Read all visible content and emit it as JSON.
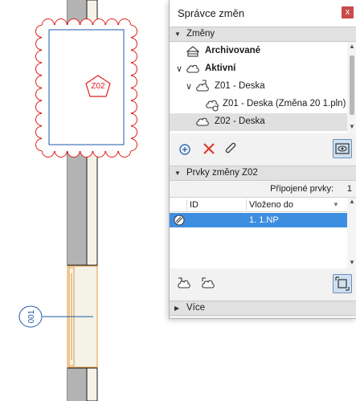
{
  "drawing": {
    "revision_tag": "Z02",
    "marker_label": "001"
  },
  "palette": {
    "title": "Správce změn",
    "close_label": "x",
    "changes_section": "Změny",
    "tree": [
      {
        "label": "Archivované",
        "bold": true,
        "expander": "",
        "icon": "archive-icon"
      },
      {
        "label": "Aktivní",
        "bold": true,
        "expander": "∨",
        "icon": "cloud-icon"
      },
      {
        "label": "Z01 - Deska",
        "bold": false,
        "expander": "∨",
        "icon": "issue-cloud-icon"
      },
      {
        "label": "Z01 - Deska (Změna 20 1.pln)",
        "bold": false,
        "expander": "",
        "icon": "linked-cloud-icon"
      },
      {
        "label": "Z02 - Deska",
        "bold": false,
        "expander": "",
        "icon": "cloud-icon"
      }
    ],
    "elements_section": "Prvky změny Z02",
    "connected_label": "Připojené prvky:",
    "connected_count": "1",
    "columns": {
      "id": "ID",
      "placed_in": "Vloženo do"
    },
    "rows": [
      {
        "id": "",
        "placed_in": "1. 1.NP",
        "icon": "slab-element-icon"
      }
    ],
    "more_section": "Více",
    "colors": {
      "selection": "#3d8ee0",
      "delete": "#e03a2f",
      "close": "#c94a4a",
      "revision_cloud": "#e0201b",
      "drawing_blue": "#1d5aa8",
      "window_orange": "#e59b3c"
    }
  }
}
